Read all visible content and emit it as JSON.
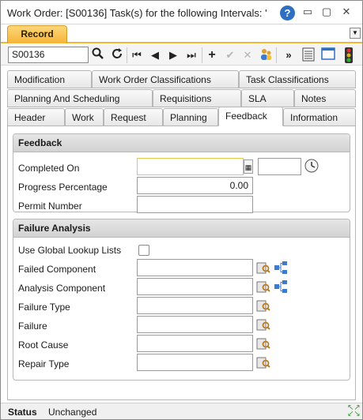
{
  "window": {
    "title": "Work Order: [S00136] Task(s) for the following Intervals: '",
    "help_glyph": "?",
    "minimize_glyph": "▭",
    "maximize_glyph": "▢",
    "close_glyph": "✕"
  },
  "record_tab": {
    "label": "Record"
  },
  "toolbar": {
    "record_id": "S00136",
    "search_icon": "search-icon",
    "refresh_icon": "refresh-icon"
  },
  "tabs": {
    "row1": [
      "Modification",
      "Work Order Classifications",
      "Task Classifications"
    ],
    "row2": [
      "Planning And Scheduling",
      "Requisitions",
      "SLA",
      "Notes"
    ],
    "row3": [
      "Header",
      "Work",
      "Request",
      "Planning",
      "Feedback",
      "Information"
    ],
    "active": "Feedback"
  },
  "feedback": {
    "heading": "Feedback",
    "completed_on_label": "Completed On",
    "completed_on_value": "",
    "completed_time_value": "",
    "progress_label": "Progress Percentage",
    "progress_value": "0.00",
    "permit_label": "Permit Number",
    "permit_value": ""
  },
  "failure": {
    "heading": "Failure Analysis",
    "global_lookup_label": "Use Global Lookup Lists",
    "global_lookup_checked": false,
    "fields": [
      {
        "label": "Failed Component",
        "value": ""
      },
      {
        "label": "Analysis Component",
        "value": ""
      },
      {
        "label": "Failure Type",
        "value": ""
      },
      {
        "label": "Failure",
        "value": ""
      },
      {
        "label": "Root Cause",
        "value": ""
      },
      {
        "label": "Repair Type",
        "value": ""
      }
    ]
  },
  "status": {
    "label": "Status",
    "value": "Unchanged"
  },
  "colors": {
    "record_tab": "#f6b437",
    "help_button": "#2f6fc2",
    "section_header": "#d8d8d8"
  }
}
